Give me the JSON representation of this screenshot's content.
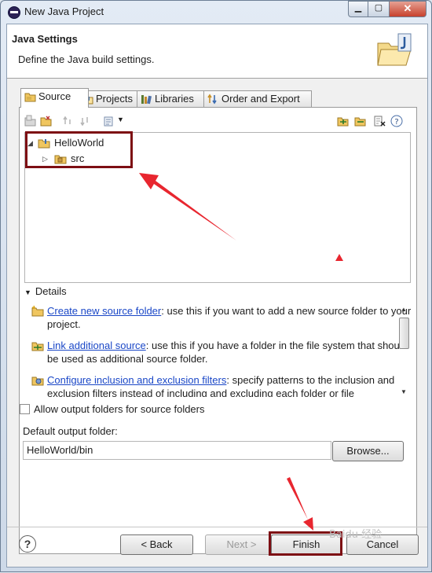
{
  "window": {
    "title": "New Java Project",
    "min_glyph": "▁",
    "max_glyph": "▢",
    "close_glyph": "✕"
  },
  "header": {
    "title": "Java Settings",
    "description": "Define the Java build settings."
  },
  "tabs": [
    {
      "label": "Source",
      "icon": "source-folder-icon",
      "active": true
    },
    {
      "label": "Projects",
      "icon": "projects-icon",
      "active": false
    },
    {
      "label": "Libraries",
      "icon": "libraries-icon",
      "active": false
    },
    {
      "label": "Order and Export",
      "icon": "order-export-icon",
      "active": false
    }
  ],
  "tree": {
    "project": "HelloWorld",
    "expand_glyph": "◢",
    "child": "src",
    "child_expand_glyph": "▷"
  },
  "details": {
    "header": "Details",
    "header_glyph": "▼",
    "items": [
      {
        "link": "Create new source folder",
        "text": ": use this if you want to add a new source folder to your project.",
        "icon": "new-source-folder-icon"
      },
      {
        "link": "Link additional source",
        "text": ": use this if you have a folder in the file system that should be used as additional source folder.",
        "icon": "link-source-icon"
      },
      {
        "link": "Configure inclusion and exclusion filters",
        "text": ": specify patterns to the inclusion and exclusion filters instead of including and excluding each folder or file",
        "icon": "filter-config-icon"
      }
    ]
  },
  "output": {
    "checkbox_label": "Allow output folders for source folders",
    "checked": false,
    "folder_label": "Default output folder:",
    "folder_value": "HelloWorld/bin",
    "browse_label": "Browse..."
  },
  "buttons": {
    "help": "?",
    "back": "< Back",
    "next": "Next >",
    "finish": "Finish",
    "cancel": "Cancel",
    "next_enabled": false
  },
  "watermark": "Baidu 经验",
  "colors": {
    "annotation": "#7d0e13",
    "arrow": "#e8262f",
    "link": "#1a47c7"
  }
}
